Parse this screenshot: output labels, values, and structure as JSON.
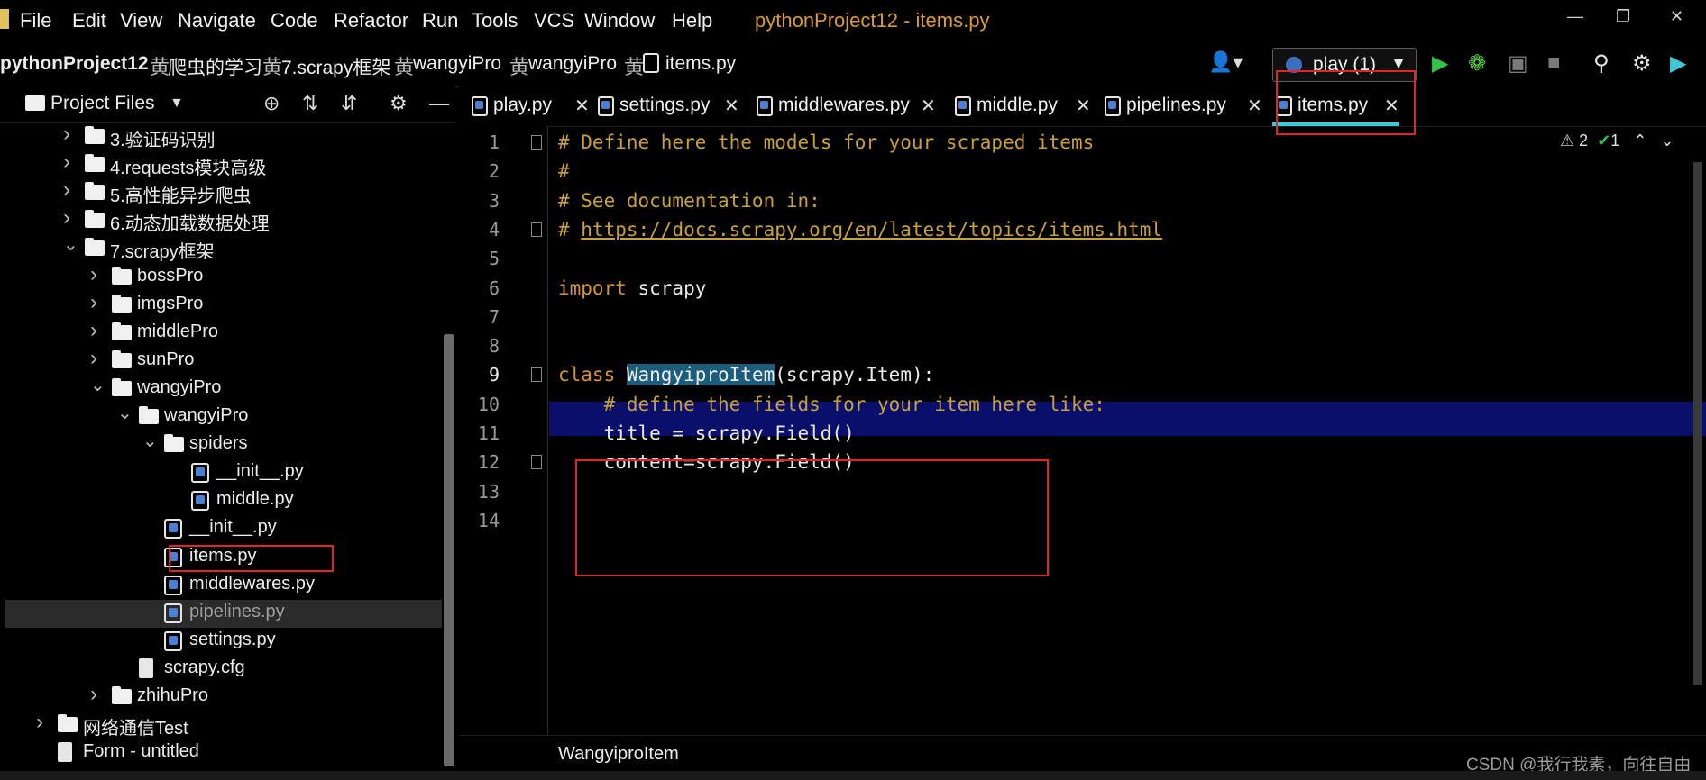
{
  "menubar": {
    "items": [
      "File",
      "Edit",
      "View",
      "Navigate",
      "Code",
      "Refactor",
      "Run",
      "Tools",
      "VCS",
      "Window",
      "Help"
    ],
    "window_title": "pythonProject12 - items.py"
  },
  "navbar": {
    "crumbs": [
      "pythonProject12",
      "爬虫的学习",
      "7.scrapy框架",
      "wangyiPro",
      "wangyiPro",
      "items.py"
    ],
    "run_config": "play (1)"
  },
  "project_panel": {
    "title": "Project Files",
    "tree": [
      {
        "label": "3.验证码识别",
        "type": "folder",
        "expanded": false
      },
      {
        "label": "4.requests模块高级",
        "type": "folder",
        "expanded": false
      },
      {
        "label": "5.高性能异步爬虫",
        "type": "folder",
        "expanded": false
      },
      {
        "label": "6.动态加载数据处理",
        "type": "folder",
        "expanded": false
      },
      {
        "label": "7.scrapy框架",
        "type": "folder",
        "expanded": true
      },
      {
        "label": "bossPro",
        "type": "folder",
        "expanded": false
      },
      {
        "label": "imgsPro",
        "type": "folder",
        "expanded": false
      },
      {
        "label": "middlePro",
        "type": "folder",
        "expanded": false
      },
      {
        "label": "sunPro",
        "type": "folder",
        "expanded": false
      },
      {
        "label": "wangyiPro",
        "type": "folder",
        "expanded": true
      },
      {
        "label": "wangyiPro",
        "type": "package",
        "expanded": true
      },
      {
        "label": "spiders",
        "type": "package",
        "expanded": true
      },
      {
        "label": "__init__.py",
        "type": "py"
      },
      {
        "label": "middle.py",
        "type": "py"
      },
      {
        "label": "__init__.py",
        "type": "py"
      },
      {
        "label": "items.py",
        "type": "py"
      },
      {
        "label": "middlewares.py",
        "type": "py"
      },
      {
        "label": "pipelines.py",
        "type": "py",
        "selected": true
      },
      {
        "label": "settings.py",
        "type": "py"
      },
      {
        "label": "scrapy.cfg",
        "type": "cfg"
      },
      {
        "label": "zhihuPro",
        "type": "folder",
        "expanded": false
      },
      {
        "label": "网络通信Test",
        "type": "folder",
        "expanded": false
      },
      {
        "label": "Form - untitled",
        "type": "doc"
      }
    ]
  },
  "tabs": [
    "play.py",
    "settings.py",
    "middlewares.py",
    "middle.py",
    "pipelines.py",
    "items.py"
  ],
  "active_tab": "items.py",
  "editor": {
    "line_numbers": [
      "1",
      "2",
      "3",
      "4",
      "5",
      "6",
      "7",
      "8",
      "9",
      "10",
      "11",
      "12",
      "13",
      "14"
    ],
    "lines": [
      {
        "t": "# Define here the models for your scraped items",
        "style": "cm"
      },
      {
        "t": "#",
        "style": "cm"
      },
      {
        "t": "# See documentation in:",
        "style": "cm"
      },
      {
        "t": "https://docs.scrapy.org/en/latest/topics/items.html",
        "style": "link",
        "prefix": "# "
      },
      {
        "t": "",
        "style": ""
      },
      {
        "kw": "import",
        "rest": " scrapy"
      },
      {
        "t": "",
        "style": ""
      },
      {
        "t": "",
        "style": ""
      },
      {
        "kw": "class",
        "cls": "WangyiproItem",
        "rest": "(scrapy.Item):"
      },
      {
        "t": "    # define the fields for your item here like:",
        "style": "cm"
      },
      {
        "t": "    title = scrapy.Field()",
        "style": ""
      },
      {
        "t": "    content=scrapy.Field()",
        "style": ""
      },
      {
        "t": "",
        "style": ""
      },
      {
        "t": "",
        "style": ""
      }
    ],
    "inspections": {
      "warnings": "2",
      "ok": "1"
    },
    "breadcrumb": "WangyiproItem"
  },
  "watermark": "CSDN @我行我素，向往自由",
  "colors": {
    "accent": "#3ec7d6",
    "annotation": "#e0262a",
    "comment": "#c8a13a",
    "keyword": "#d9952f",
    "current_line": "#0a0f6b"
  }
}
